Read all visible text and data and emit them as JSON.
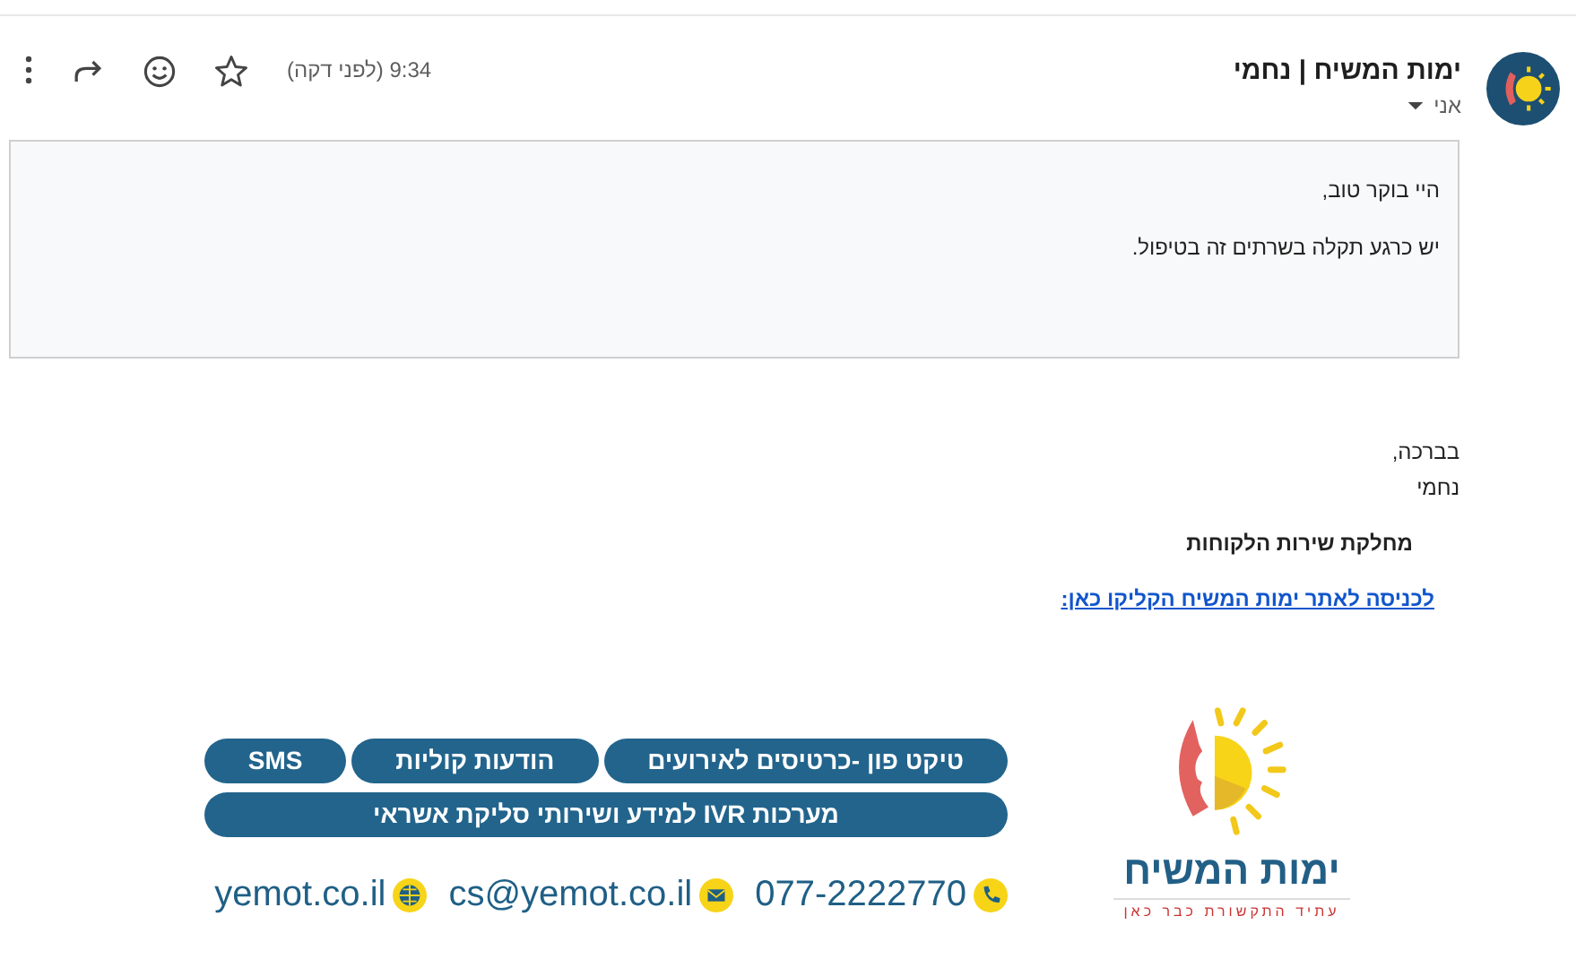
{
  "sender": {
    "name": "ימות המשיח | נחמי",
    "recipient": "אני"
  },
  "time": "9:34 (לפני דקה)",
  "starred": false,
  "quoted": [
    "היי בוקר טוב,",
    "יש כרגע תקלה בשרתים זה בטיפול."
  ],
  "signature": {
    "greeting": "בברכה,",
    "name": "נחמי",
    "department": "מחלקת שירות הלקוחות",
    "link": "לכניסה לאתר ימות המשיח הקליקו כאן:"
  },
  "banner": {
    "logo_name": "ימות המשיח",
    "logo_tagline": "עתיד התקשורת כבר כאן",
    "service_rows": [
      [
        "טיקט פון -כרטיסים לאירועים",
        "הודעות קוליות",
        "SMS"
      ],
      [
        "מערכות IVR למידע ושירותי סליקת אשראי"
      ]
    ],
    "contacts": [
      {
        "kind": "phone",
        "text": "077-2222770"
      },
      {
        "kind": "email",
        "text": "cs@yemot.co.il"
      },
      {
        "kind": "web",
        "text": "yemot.co.il"
      }
    ]
  }
}
